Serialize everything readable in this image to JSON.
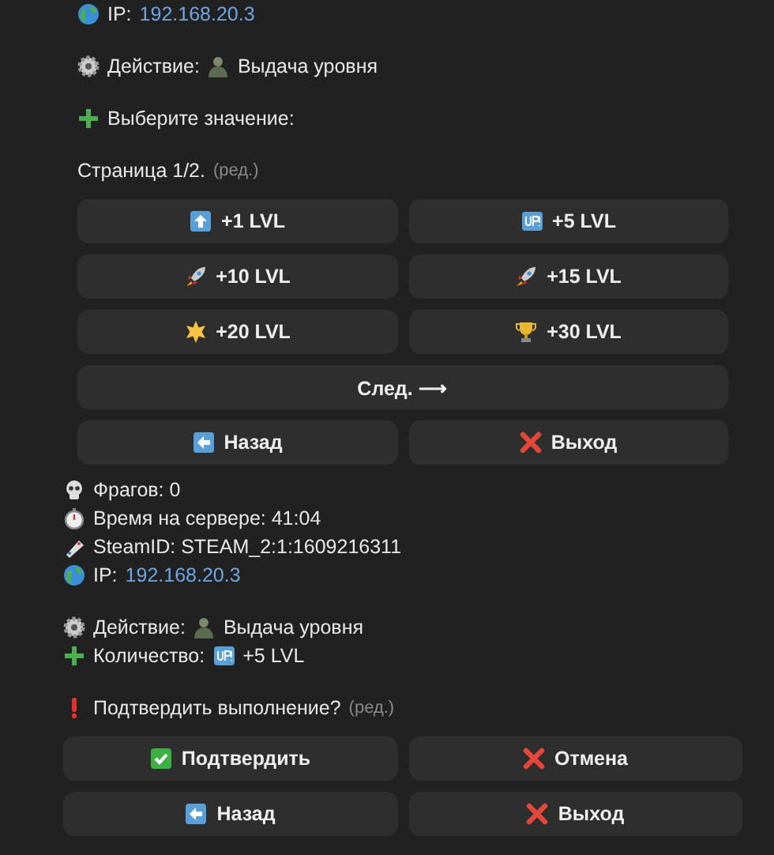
{
  "messages": [
    {
      "paragraphs": [
        [
          {
            "label": "IP:",
            "value": "192.168.20.3",
            "link": true
          }
        ],
        [
          {
            "label": "Действие:",
            "value": "Выдача уровня",
            "link": false
          }
        ],
        [
          {
            "label": "Выберите значение:"
          }
        ],
        [
          {
            "label": "Страница 1/2.",
            "note": "(ред.)"
          }
        ]
      ],
      "keyboard": [
        [
          {
            "label": "+1 LVL"
          },
          {
            "label": "+5 LVL"
          }
        ],
        [
          {
            "label": "+10 LVL"
          },
          {
            "label": "+15 LVL"
          }
        ],
        [
          {
            "label": "+20 LVL"
          },
          {
            "label": "+30 LVL"
          }
        ],
        [
          {
            "label": "След. ⟶"
          }
        ],
        [
          {
            "label": "Назад"
          },
          {
            "label": "Выход"
          }
        ]
      ]
    },
    {
      "paragraphs": [
        [
          {
            "label": "Фрагов: 0"
          },
          {
            "label": "Время на сервере: 41:04"
          },
          {
            "label": "SteamID: STEAM_2:1:1609216311"
          },
          {
            "label": "IP:",
            "value": "192.168.20.3",
            "link": true
          }
        ],
        [
          {
            "label": "Действие:",
            "value": "Выдача уровня",
            "link": false
          },
          {
            "label": "Количество:",
            "value": "+5 LVL",
            "link": false
          }
        ],
        [
          {
            "label": "Подтвердить выполнение?",
            "note": "(ред.)"
          }
        ]
      ],
      "keyboard": [
        [
          {
            "label": "Подтвердить"
          },
          {
            "label": "Отмена"
          }
        ],
        [
          {
            "label": "Назад"
          },
          {
            "label": "Выход"
          }
        ]
      ]
    }
  ]
}
